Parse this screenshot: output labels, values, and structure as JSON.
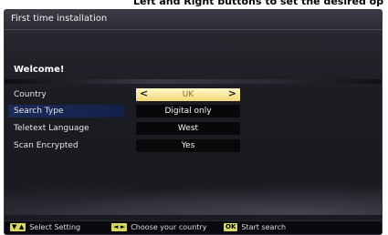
{
  "banner": {
    "text": "Left and Right buttons to set the desired op"
  },
  "window": {
    "title": "First time installation"
  },
  "welcome": "Welcome!",
  "settings": [
    {
      "label": "Country",
      "value": "UK",
      "left_arrow": "<",
      "right_arrow": ">"
    },
    {
      "label": "Search Type",
      "value": "Digital only"
    },
    {
      "label": "Teletext Language",
      "value": "West"
    },
    {
      "label": "Scan Encrypted",
      "value": "Yes"
    }
  ],
  "footer": {
    "select_key": "▼ ▲",
    "select_label": "Select Setting",
    "choose_key": "◄ ►",
    "choose_label": "Choose your country",
    "ok_key": "OK",
    "ok_label": "Start search"
  },
  "colors": {
    "highlight": "#f3d77a",
    "selected_row": "#1c2a5a",
    "key_yellow": "#d8d860"
  }
}
